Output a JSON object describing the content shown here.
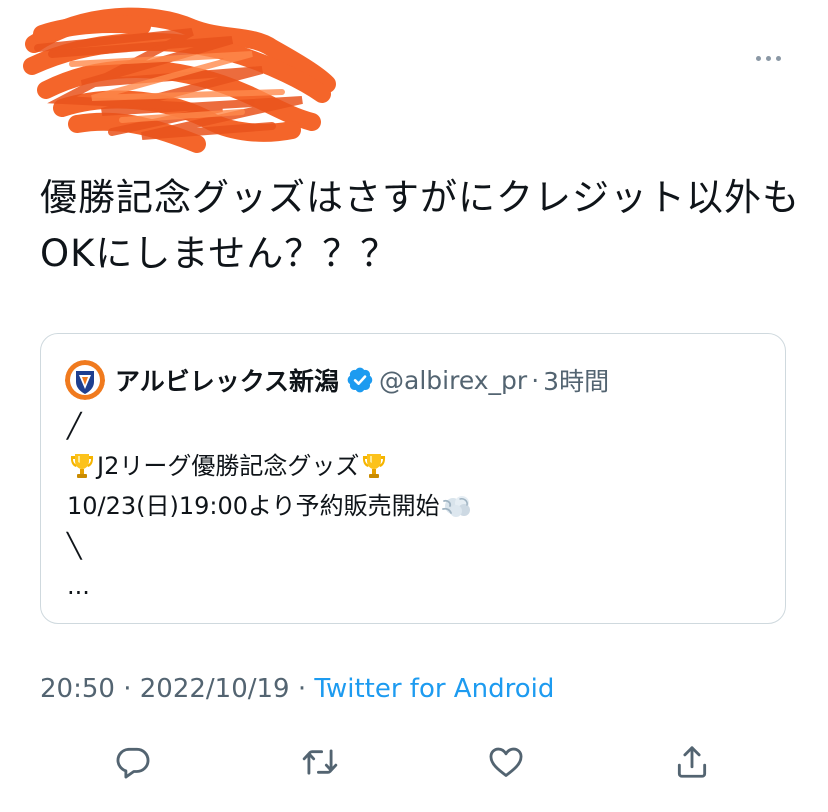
{
  "tweet": {
    "text": "優勝記念グッズはさすがにクレジット以外もOKにしません？？？",
    "meta": {
      "time": "20:50",
      "separator": " · ",
      "date": "2022/10/19",
      "source": "Twitter for Android"
    }
  },
  "quoted_tweet": {
    "display_name": "アルビレックス新潟",
    "handle": "@albirex_pr",
    "separator": "·",
    "time": "3時間",
    "lines": [
      "╱",
      "J2リーグ優勝記念グッズ",
      "10/23(日)19:00より予約販売開始",
      "╲",
      "..."
    ]
  },
  "colors": {
    "text": "#0f1419",
    "secondary": "#536471",
    "link": "#1d9bf0",
    "border": "#cfd9de",
    "verified": "#1d9bf0",
    "redaction": "#f4652a"
  },
  "icons": {
    "more": "more-horizontal-icon",
    "reply": "reply-icon",
    "retweet": "retweet-icon",
    "like": "heart-icon",
    "share": "share-icon",
    "verified": "verified-badge-icon",
    "trophy": "trophy-emoji",
    "dash": "dash-emoji"
  }
}
